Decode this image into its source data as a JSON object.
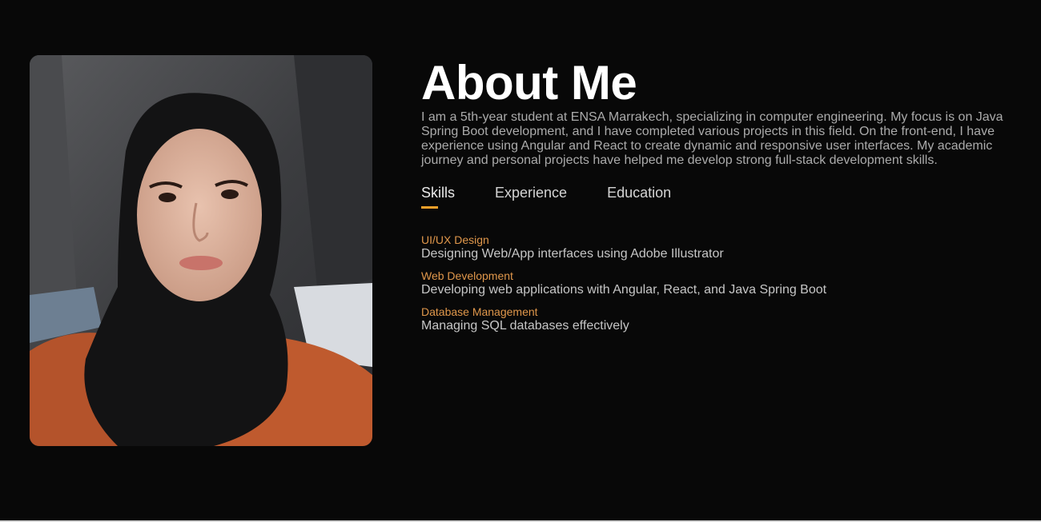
{
  "about": {
    "title": "About Me",
    "bio": "I am a 5th-year student at ENSA Marrakech, specializing in computer engineering. My focus is on Java Spring Boot development, and I have completed various projects in this field. On the front-end, I have experience using Angular and React to create dynamic and responsive user interfaces. My academic journey and personal projects have helped me develop strong full-stack development skills."
  },
  "tabs": [
    {
      "label": "Skills",
      "active": true
    },
    {
      "label": "Experience",
      "active": false
    },
    {
      "label": "Education",
      "active": false
    }
  ],
  "skills": [
    {
      "name": "UI/UX Design",
      "description": "Designing Web/App interfaces using Adobe Illustrator"
    },
    {
      "name": "Web Development",
      "description": "Developing web applications with Angular, React, and Java Spring Boot"
    },
    {
      "name": "Database Management",
      "description": "Managing SQL databases effectively"
    }
  ],
  "colors": {
    "background": "#080808",
    "accent": "#f5a12a",
    "skill_name": "#e0974b"
  }
}
